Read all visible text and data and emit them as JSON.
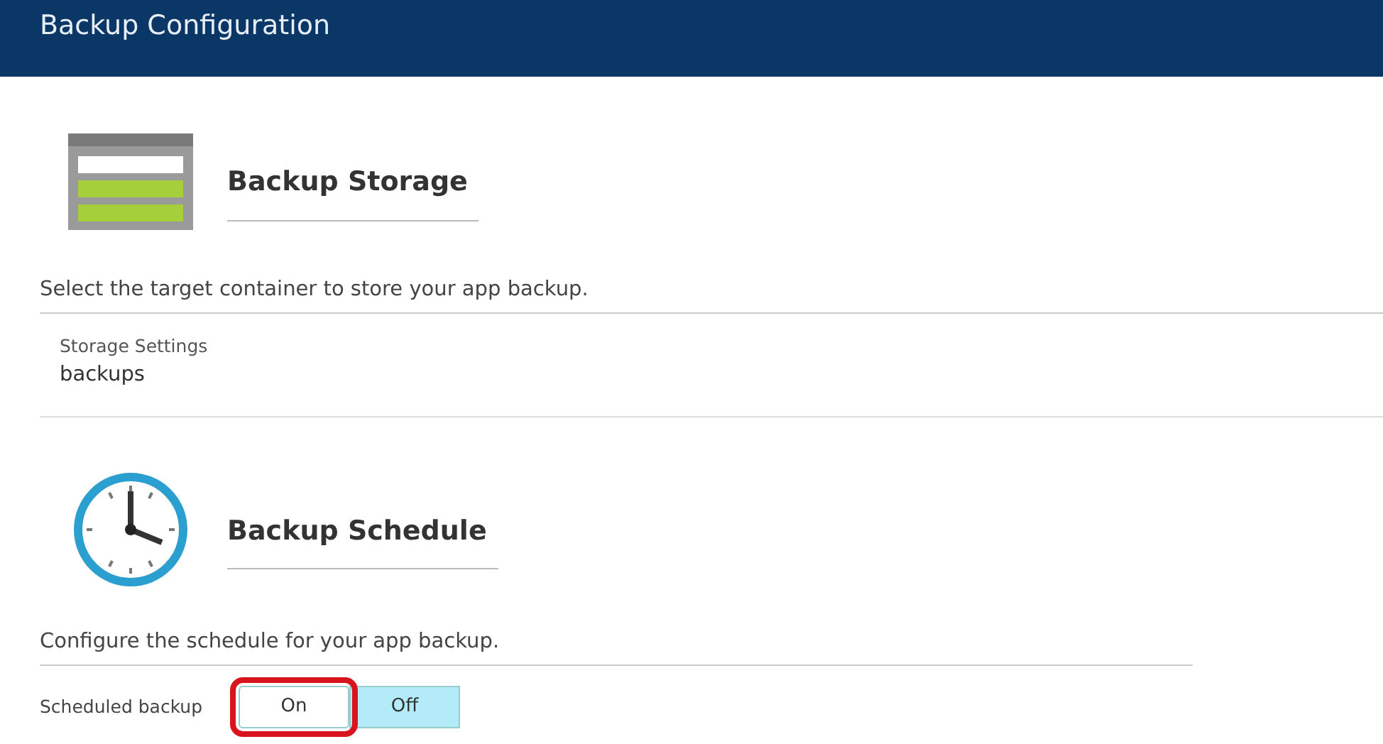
{
  "window": {
    "title": "Backup Configuration"
  },
  "sections": [
    {
      "kind": "storage",
      "heading": "Backup Storage",
      "description": "Select the target container to store your app backup.",
      "setting": {
        "label": "Storage Settings",
        "value": "backups"
      }
    },
    {
      "kind": "schedule",
      "heading": "Backup Schedule",
      "description": "Configure the schedule for your app backup.",
      "toggle": {
        "label": "Scheduled backup",
        "options": [
          {
            "label": "On",
            "selected": false,
            "highlighted": true
          },
          {
            "label": "Off",
            "selected": true,
            "highlighted": false
          }
        ]
      }
    }
  ]
}
